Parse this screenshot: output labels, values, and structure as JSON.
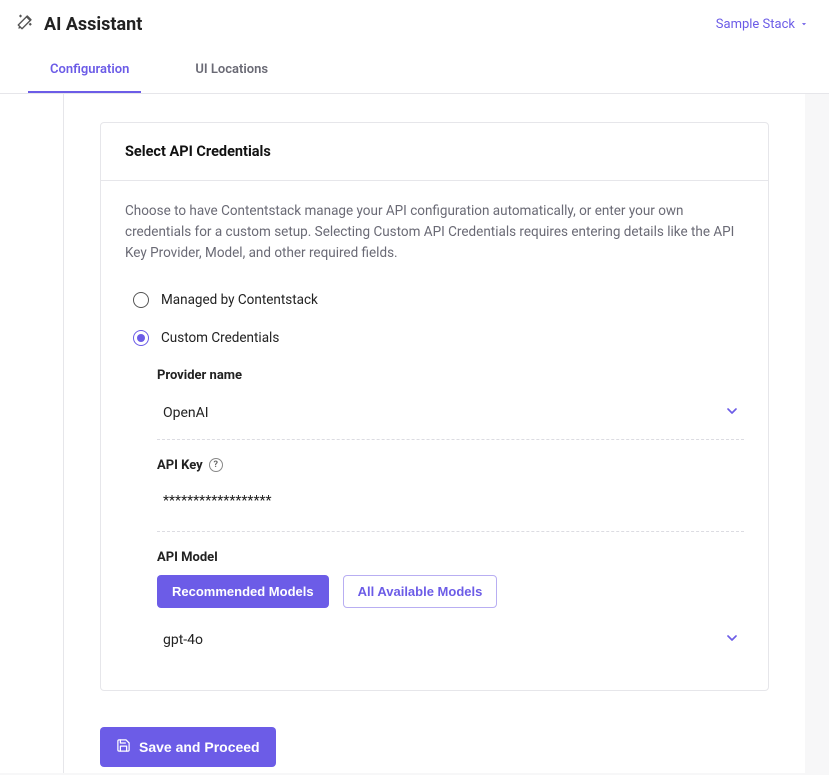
{
  "header": {
    "title": "AI Assistant",
    "stack_label": "Sample Stack"
  },
  "tabs": {
    "configuration": "Configuration",
    "ui_locations": "UI Locations"
  },
  "card": {
    "title": "Select API Credentials",
    "description": "Choose to have Contentstack manage your API configuration automatically, or enter your own credentials for a custom setup. Selecting Custom API Credentials requires entering details like the API Key Provider, Model, and other required fields."
  },
  "radios": {
    "managed": "Managed by Contentstack",
    "custom": "Custom Credentials"
  },
  "fields": {
    "provider_label": "Provider name",
    "provider_value": "OpenAI",
    "apikey_label": "API Key",
    "apikey_value": "******************",
    "model_label": "API Model",
    "recommended_btn": "Recommended Models",
    "all_btn": "All Available Models",
    "model_value": "gpt-4o"
  },
  "footer": {
    "save": "Save and Proceed"
  }
}
